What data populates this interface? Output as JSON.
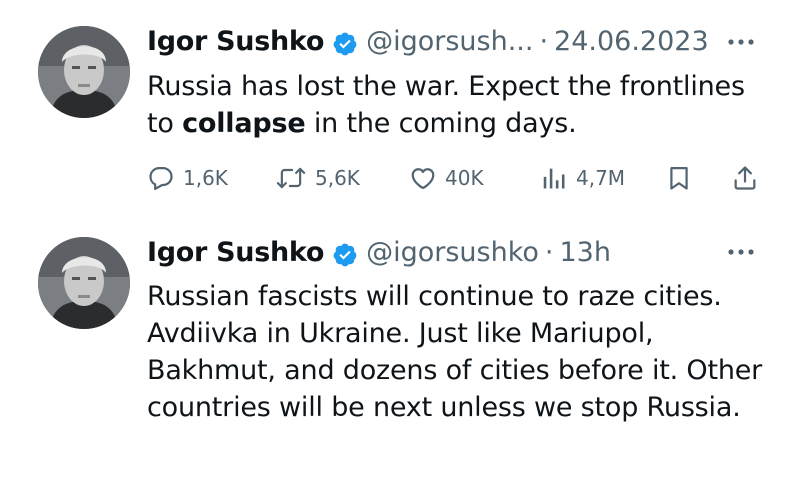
{
  "tweets": [
    {
      "author_name": "Igor Sushko",
      "handle": "@igorsush...",
      "separator": "·",
      "time": "24.06.2023",
      "text_before": "Russia has lost the war. Expect the frontlines to ",
      "text_bold": "collapse",
      "text_after": " in the coming days.",
      "actions": {
        "replies": "1,6K",
        "reposts": "5,6K",
        "likes": "40K",
        "views": "4,7M"
      }
    },
    {
      "author_name": "Igor Sushko",
      "handle": "@igorsushko",
      "separator": "·",
      "time": "13h",
      "text": "Russian fascists will continue to raze cities. Avdiivka in Ukraine. Just like Mariupol, Bakhmut, and dozens of cities before it. Other countries will be next unless we stop Russia."
    }
  ],
  "colors": {
    "text": "#0f1419",
    "secondary": "#536471",
    "verified": "#1d9bf0",
    "background": "#ffffff"
  },
  "icons": {
    "verified": "verified-badge-icon",
    "more": "more-dots-icon",
    "reply": "reply-bubble-icon",
    "repost": "repost-arrows-icon",
    "like": "heart-icon",
    "views": "views-bars-icon",
    "bookmark": "bookmark-icon",
    "share": "share-upload-icon"
  }
}
